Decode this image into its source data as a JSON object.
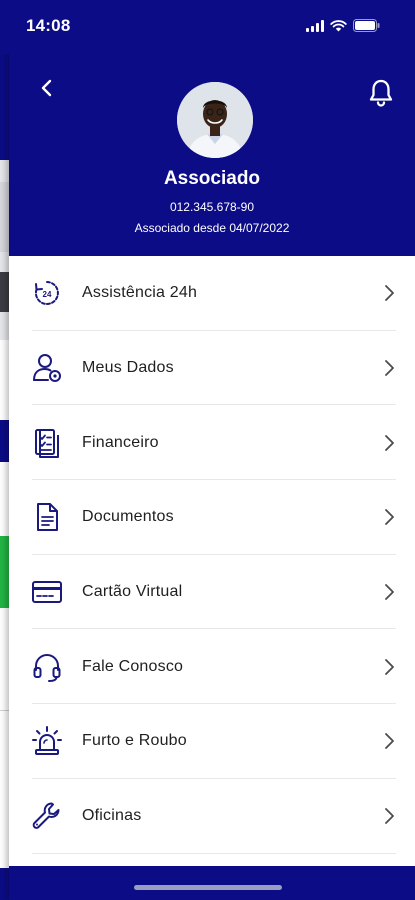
{
  "status_bar": {
    "time": "14:08"
  },
  "profile": {
    "name": "Associado",
    "document": "012.345.678-90",
    "since": "Associado desde 04/07/2022"
  },
  "menu": {
    "items": [
      {
        "label": "Assistência 24h",
        "icon": "assistance-24h-icon"
      },
      {
        "label": "Meus Dados",
        "icon": "user-settings-icon"
      },
      {
        "label": "Financeiro",
        "icon": "financial-document-icon"
      },
      {
        "label": "Documentos",
        "icon": "document-icon"
      },
      {
        "label": "Cartão Virtual",
        "icon": "card-icon"
      },
      {
        "label": "Fale Conosco",
        "icon": "headset-icon"
      },
      {
        "label": "Furto e Roubo",
        "icon": "alarm-siren-icon"
      },
      {
        "label": "Oficinas",
        "icon": "wrench-icon"
      }
    ]
  },
  "colors": {
    "brand": "#0c0c86",
    "icon": "#1a1a7e",
    "text": "#1f1f1f"
  }
}
